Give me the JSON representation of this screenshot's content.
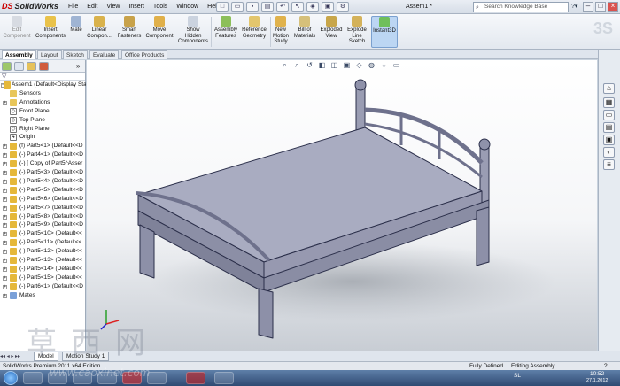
{
  "app": {
    "logo_prefix": "DS",
    "logo": "SolidWorks",
    "doc_title": "Assem1 *"
  },
  "menu": [
    "File",
    "Edit",
    "View",
    "Insert",
    "Tools",
    "Window",
    "Help"
  ],
  "search": {
    "placeholder": "Search Knowledge Base"
  },
  "ribbon": [
    {
      "label": "Edit\nComponent",
      "disabled": true
    },
    {
      "label": "Insert\nComponents"
    },
    {
      "label": "Mate"
    },
    {
      "label": "Linear\nCompon..."
    },
    {
      "label": "Smart\nFasteners"
    },
    {
      "label": "Move\nComponent"
    },
    {
      "label": "Show\nHidden\nComponents"
    },
    {
      "label": "Assembly\nFeatures"
    },
    {
      "label": "Reference\nGeometry"
    },
    {
      "label": "New\nMotion\nStudy"
    },
    {
      "label": "Bill of\nMaterials"
    },
    {
      "label": "Exploded\nView"
    },
    {
      "label": "Explode\nLine\nSketch"
    },
    {
      "label": "Instant3D",
      "active": true
    }
  ],
  "command_tabs": [
    "Assembly",
    "Layout",
    "Sketch",
    "Evaluate",
    "Office Products"
  ],
  "tree": {
    "filter_label": "▽",
    "root": "Assem1  (Default<Display Sta",
    "items": [
      {
        "label": "Sensors",
        "type": "folder"
      },
      {
        "label": "Annotations",
        "type": "annot"
      },
      {
        "label": "Front Plane",
        "type": "plane"
      },
      {
        "label": "Top Plane",
        "type": "plane"
      },
      {
        "label": "Right Plane",
        "type": "plane"
      },
      {
        "label": "Origin",
        "type": "origin"
      },
      {
        "label": "(f) Part5<1> (Default<<D",
        "type": "part"
      },
      {
        "label": "(-) Part4<1> (Default<<D",
        "type": "part"
      },
      {
        "label": "(-) [ Copy of Part5^Asser",
        "type": "part"
      },
      {
        "label": "(-) Part5<3> (Default<<D",
        "type": "part"
      },
      {
        "label": "(-) Part5<4> (Default<<D",
        "type": "part"
      },
      {
        "label": "(-) Part5<5> (Default<<D",
        "type": "part"
      },
      {
        "label": "(-) Part5<6> (Default<<D",
        "type": "part"
      },
      {
        "label": "(-) Part5<7> (Default<<D",
        "type": "part"
      },
      {
        "label": "(-) Part5<8> (Default<<D",
        "type": "part"
      },
      {
        "label": "(-) Part5<9> (Default<<D",
        "type": "part"
      },
      {
        "label": "(-) Part5<10> (Default<<",
        "type": "part"
      },
      {
        "label": "(-) Part5<11> (Default<<",
        "type": "part"
      },
      {
        "label": "(-) Part5<12> (Default<<",
        "type": "part"
      },
      {
        "label": "(-) Part5<13> (Default<<",
        "type": "part"
      },
      {
        "label": "(-) Part5<14> (Default<<",
        "type": "part"
      },
      {
        "label": "(-) Part5<15> (Default<<",
        "type": "part"
      },
      {
        "label": "(-) Part6<1> (Default<<D",
        "type": "part"
      },
      {
        "label": "Mates",
        "type": "mates"
      }
    ]
  },
  "bottom_tabs": [
    "Model",
    "Motion Study 1"
  ],
  "status": {
    "edition": "SolidWorks Premium 2011 x64 Edition",
    "state": "Fully Defined",
    "mode": "Editing Assembly",
    "help": "?"
  },
  "tray": {
    "lang": "SL",
    "time": "10:52",
    "date": "27.1.2012"
  },
  "watermark": {
    "text": "草西网",
    "url": "www.caoxinet.com"
  },
  "colors": {
    "accent": "#c00000",
    "model_fill": "#a9acc1",
    "model_edge": "#2b2f4a",
    "ribbon_active": "#bcd6f3"
  }
}
